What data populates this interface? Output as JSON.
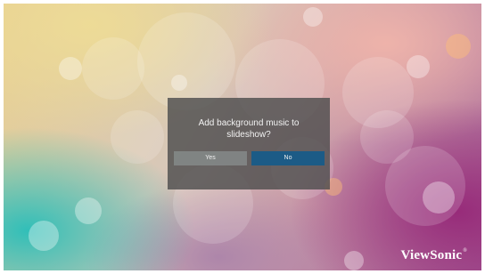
{
  "dialog": {
    "message_line1": "Add background music to",
    "message_line2": "slideshow?",
    "yes_label": "Yes",
    "no_label": "No"
  },
  "brand": {
    "logo_text": "ViewSonic",
    "trademark": "®"
  }
}
